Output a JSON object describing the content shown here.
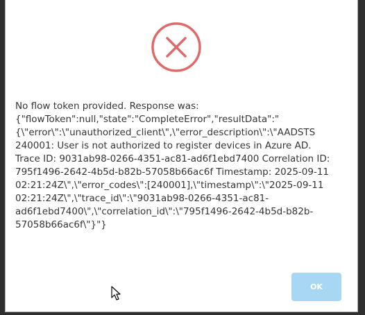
{
  "dialog": {
    "icon": "error-x-circle-icon",
    "accent_color": "#e06a6a",
    "message": "No flow token provided. Response was:\n{\"flowToken\":null,\"state\":\"CompleteError\",\"resultData\":\"\n{\\\"error\\\":\\\"unauthorized_client\\\",\\\"error_description\\\":\\\"AADSTS\n240001: User is not authorized to register devices in Azure AD.\nTrace ID: 9031ab98-0266-4351-ac81-ad6f1ebd7400 Correlation ID:\n795f1496-2642-4b5d-b82b-57058b66ac6f Timestamp: 2025-09-11\n02:21:24Z\\\",\\\"error_codes\\\":[240001],\\\"timestamp\\\":\\\"2025-09-11\n02:21:24Z\\\",\\\"trace_id\\\":\\\"9031ab98-0266-4351-ac81-\nad6f1ebd7400\\\",\\\"correlation_id\\\":\\\"795f1496-2642-4b5d-b82b-\n57058b66ac6f\\\"}\"}",
    "ok_label": "OK",
    "ok_color": "#a8d7f4"
  },
  "cursor": {
    "icon": "mouse-pointer-icon"
  }
}
